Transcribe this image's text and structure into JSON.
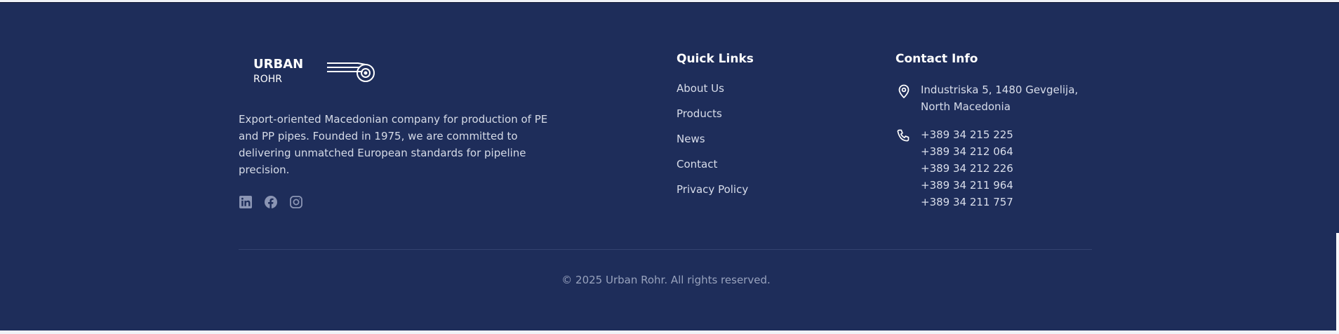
{
  "brand": {
    "logo_line1": "URBAN",
    "logo_line2": "ROHR",
    "description": "Export-oriented Macedonian company for production of PE and PP pipes. Founded in 1975, we are committed to delivering unmatched European standards for pipeline precision."
  },
  "socials": [
    {
      "name": "linkedin",
      "icon": "linkedin-icon"
    },
    {
      "name": "facebook",
      "icon": "facebook-icon"
    },
    {
      "name": "instagram",
      "icon": "instagram-icon"
    }
  ],
  "quick_links": {
    "title": "Quick Links",
    "items": [
      {
        "label": "About Us"
      },
      {
        "label": "Products"
      },
      {
        "label": "News"
      },
      {
        "label": "Contact"
      },
      {
        "label": "Privacy Policy"
      }
    ]
  },
  "contact": {
    "title": "Contact Info",
    "address_line1": "Industriska 5, 1480 Gevgelija,",
    "address_line2": "North Macedonia",
    "phones": [
      "+389 34 215 225",
      "+389 34 212 064",
      "+389 34 212 226",
      "+389 34 211 964",
      "+389 34 211 757"
    ]
  },
  "copyright": "© 2025 Urban Rohr. All rights reserved.",
  "colors": {
    "footer_bg": "#1e2d5a",
    "text": "#d8ddea",
    "muted": "#98a2bd",
    "icon_muted": "#8b95b4"
  }
}
